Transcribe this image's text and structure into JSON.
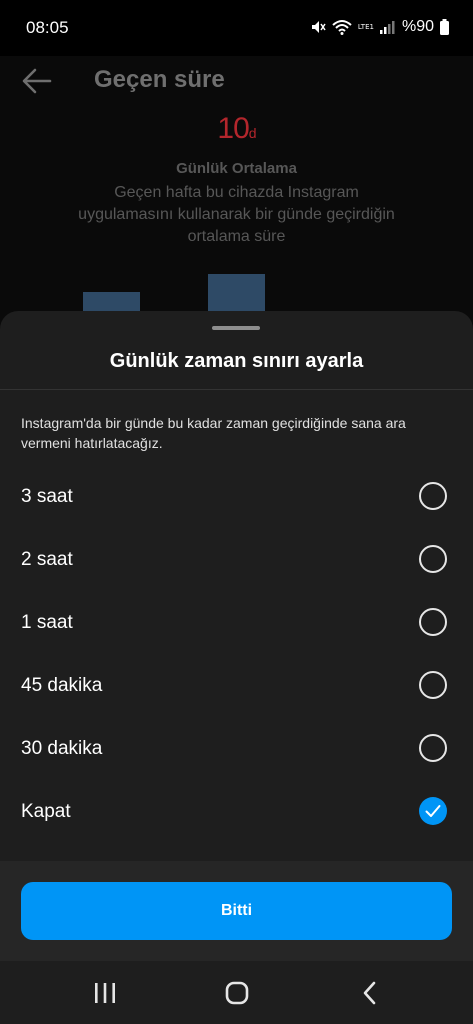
{
  "status_bar": {
    "time": "08:05",
    "network_label": "LTE1",
    "battery": "%90"
  },
  "background_page": {
    "title": "Geçen süre",
    "big_value": "10",
    "big_unit": "d",
    "subtitle": "Günlük Ortalama",
    "description": "Geçen hafta bu cihazda Instagram uygulamasını kullanarak bir günde geçirdiğin ortalama süre"
  },
  "sheet": {
    "title": "Günlük zaman sınırı ayarla",
    "description": "Instagram'da bir günde bu kadar zaman geçirdiğinde sana ara vermeni hatırlatacağız.",
    "options": [
      {
        "label": "3 saat",
        "selected": false
      },
      {
        "label": "2 saat",
        "selected": false
      },
      {
        "label": "1 saat",
        "selected": false
      },
      {
        "label": "45 dakika",
        "selected": false
      },
      {
        "label": "30 dakika",
        "selected": false
      },
      {
        "label": "Kapat",
        "selected": true
      }
    ],
    "done_label": "Bitti"
  },
  "nav_bar": {
    "icons": [
      "recent-apps-icon",
      "home-icon",
      "back-icon"
    ]
  },
  "colors": {
    "accent": "#0095f6",
    "sheet_bg": "#1e1e1e",
    "stat_red": "#b3262c"
  }
}
